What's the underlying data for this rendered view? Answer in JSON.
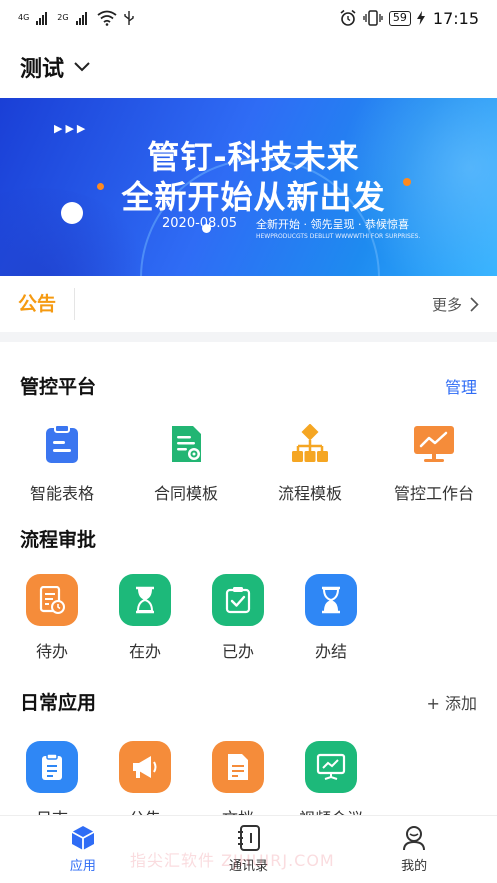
{
  "status_bar": {
    "net1": "4G",
    "net2": "2G",
    "battery": "59",
    "time": "17:15"
  },
  "header": {
    "title": "测试"
  },
  "banner": {
    "headline1": "管钉-科技未来",
    "headline2": "全新开始从新出发",
    "date": "2020-08.05",
    "tagline": "全新开始 · 领先呈现 · 恭候惊喜",
    "small_text": "HEWPRODUCGTS DEBLUT WWWWTHI FOR SURPRISES."
  },
  "notice": {
    "label": "公告",
    "more": "更多"
  },
  "platform": {
    "title": "管控平台",
    "manage": "管理",
    "items": [
      {
        "label": "智能表格",
        "icon": "clipboard-icon",
        "color": "#3b76f0"
      },
      {
        "label": "合同模板",
        "icon": "contract-doc-icon",
        "color": "#22b573"
      },
      {
        "label": "流程模板",
        "icon": "flowchart-icon",
        "color": "#f5a623"
      },
      {
        "label": "管控工作台",
        "icon": "dashboard-chart-icon",
        "color": "#f58c3a"
      }
    ]
  },
  "workflow": {
    "title": "流程审批",
    "items": [
      {
        "label": "待办",
        "icon": "pending-doc-icon",
        "color": "#f58c3a"
      },
      {
        "label": "在办",
        "icon": "hourglass-icon",
        "color": "#1db97a"
      },
      {
        "label": "已办",
        "icon": "checked-clipboard-icon",
        "color": "#1db97a"
      },
      {
        "label": "办结",
        "icon": "hourglass-icon",
        "color": "#2f87f5"
      }
    ]
  },
  "daily": {
    "title": "日常应用",
    "add": "+ 添加",
    "items": [
      {
        "label": "日志",
        "icon": "log-icon",
        "color": "#2f87f5"
      },
      {
        "label": "公告",
        "icon": "megaphone-icon",
        "color": "#f58c3a"
      },
      {
        "label": "文档",
        "icon": "document-icon",
        "color": "#f58c3a"
      },
      {
        "label": "视频会议",
        "icon": "video-meeting-icon",
        "color": "#1db97a"
      }
    ]
  },
  "tabbar": {
    "apps": "应用",
    "contacts": "通讯录",
    "mine": "我的"
  },
  "watermark": "指尖汇软件 ZJHUIRJ.COM",
  "colors": {
    "accent": "#2f6cf5",
    "notice": "#f59a12"
  }
}
